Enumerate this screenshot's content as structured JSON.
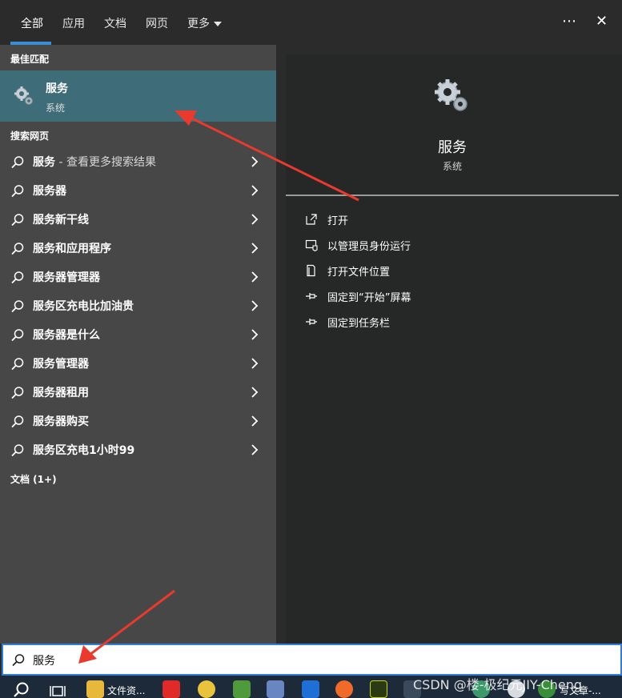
{
  "tabs": [
    {
      "label": "全部"
    },
    {
      "label": "应用"
    },
    {
      "label": "文档"
    },
    {
      "label": "网页"
    },
    {
      "label": "更多"
    }
  ],
  "top_icons": {
    "more": "⋯",
    "close": "✕"
  },
  "best_match": {
    "heading": "最佳匹配",
    "title": "服务",
    "subtitle": "系统"
  },
  "web_search": {
    "heading": "搜索网页",
    "items": [
      {
        "text": "服务",
        "suffix": " - 查看更多搜索结果"
      },
      {
        "text": "服务器",
        "suffix": ""
      },
      {
        "text": "服务新干线",
        "suffix": ""
      },
      {
        "text": "服务和应用程序",
        "suffix": ""
      },
      {
        "text": "服务器管理器",
        "suffix": ""
      },
      {
        "text": "服务区充电比加油贵",
        "suffix": ""
      },
      {
        "text": "服务器是什么",
        "suffix": ""
      },
      {
        "text": "服务管理器",
        "suffix": ""
      },
      {
        "text": "服务器租用",
        "suffix": ""
      },
      {
        "text": "服务器购买",
        "suffix": ""
      },
      {
        "text": "服务区充电1小时99",
        "suffix": ""
      }
    ]
  },
  "docs_heading": "文档 (1+)",
  "detail": {
    "title": "服务",
    "subtitle": "系统",
    "actions": [
      {
        "label": "打开",
        "icon": "open-icon"
      },
      {
        "label": "以管理员身份运行",
        "icon": "shield-run-icon"
      },
      {
        "label": "打开文件位置",
        "icon": "file-location-icon"
      },
      {
        "label": "固定到“开始”屏幕",
        "icon": "pin-icon"
      },
      {
        "label": "固定到任务栏",
        "icon": "pin-icon"
      }
    ]
  },
  "search": {
    "query": "服务"
  },
  "taskbar": {
    "file_explorer_label": "文件资...",
    "writing_label": "写文章-..."
  },
  "watermark": "CSDN @楼-极纪元JIY-Cheng",
  "colors": {
    "accent": "#3c8dd8",
    "selected_bg": "#3e6c78",
    "arrow": "#e83a2e"
  }
}
